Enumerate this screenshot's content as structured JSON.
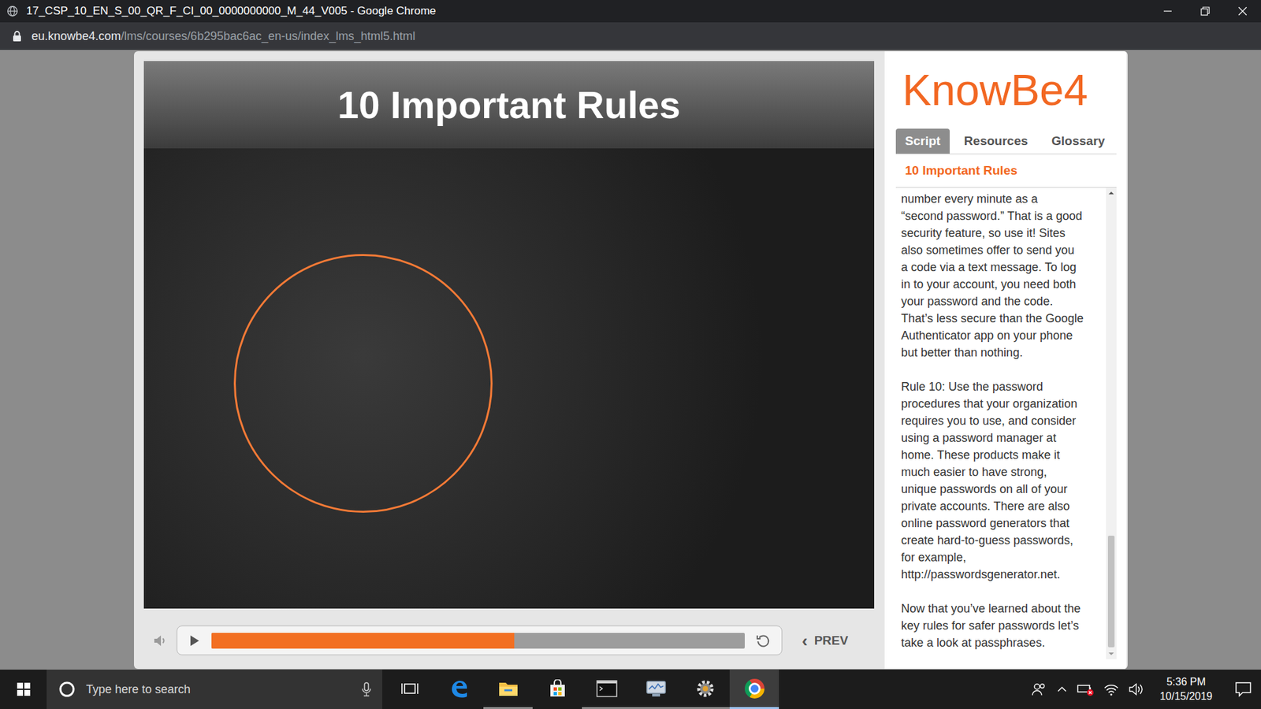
{
  "window": {
    "title": "17_CSP_10_EN_S_00_QR_F_CI_00_0000000000_M_44_V005 - Google Chrome"
  },
  "address_bar": {
    "domain": "eu.knowbe4.com",
    "path": "/lms/courses/6b295bac6ac_en-us/index_lms_html5.html"
  },
  "slide": {
    "title": "10 Important Rules"
  },
  "player": {
    "muted": false,
    "progress": {
      "level": 0.568
    },
    "prev_button": {
      "chevron": "‹",
      "label": "PREV"
    }
  },
  "panel": {
    "logo": "KnowBe4",
    "tabs": [
      {
        "label": "Script",
        "selected": true
      },
      {
        "label": "Resources",
        "selected": false
      },
      {
        "label": "Glossary",
        "selected": false
      }
    ],
    "heading": "10 Important Rules",
    "paragraphs": [
      [
        "number every minute as a",
        "“second password.” That is a good",
        "security feature, so use it! Sites",
        "also sometimes offer to send you",
        "a code via a text message. To log",
        "in to your account, you need both",
        "your password and the code.",
        "That’s less secure than the Google",
        "Authenticator app on your phone",
        "but better than nothing."
      ],
      [
        "Rule 10: Use the password",
        "procedures that your organization",
        "requires you to use, and consider",
        "using a password manager at",
        "home. These products make it",
        "much easier to have strong,",
        "unique passwords on all of your",
        "private accounts. There are also",
        "online password generators that",
        "create hard-to-guess passwords,",
        "for example,",
        "http://passwordsgenerator.net."
      ],
      [
        "Now that you’ve learned about the",
        "key rules for safer passwords let’s",
        "take a look at passphrases."
      ]
    ],
    "scrollbar": {
      "scrolled_to_end": true
    }
  },
  "taskbar": {
    "search_placeholder": "Type here to search",
    "apps": [
      {
        "kind": "task-view",
        "running": false,
        "active": false
      },
      {
        "kind": "edge",
        "running": false,
        "active": false
      },
      {
        "kind": "explorer",
        "running": true,
        "active": false
      },
      {
        "kind": "store",
        "running": false,
        "active": false
      },
      {
        "kind": "terminal",
        "running": true,
        "active": false
      },
      {
        "kind": "monitor",
        "running": true,
        "active": false
      },
      {
        "kind": "settings",
        "running": true,
        "active": false
      },
      {
        "kind": "chrome",
        "running": true,
        "active": true
      }
    ],
    "clock": {
      "time": "5:36 PM",
      "date": "10/15/2019"
    }
  }
}
